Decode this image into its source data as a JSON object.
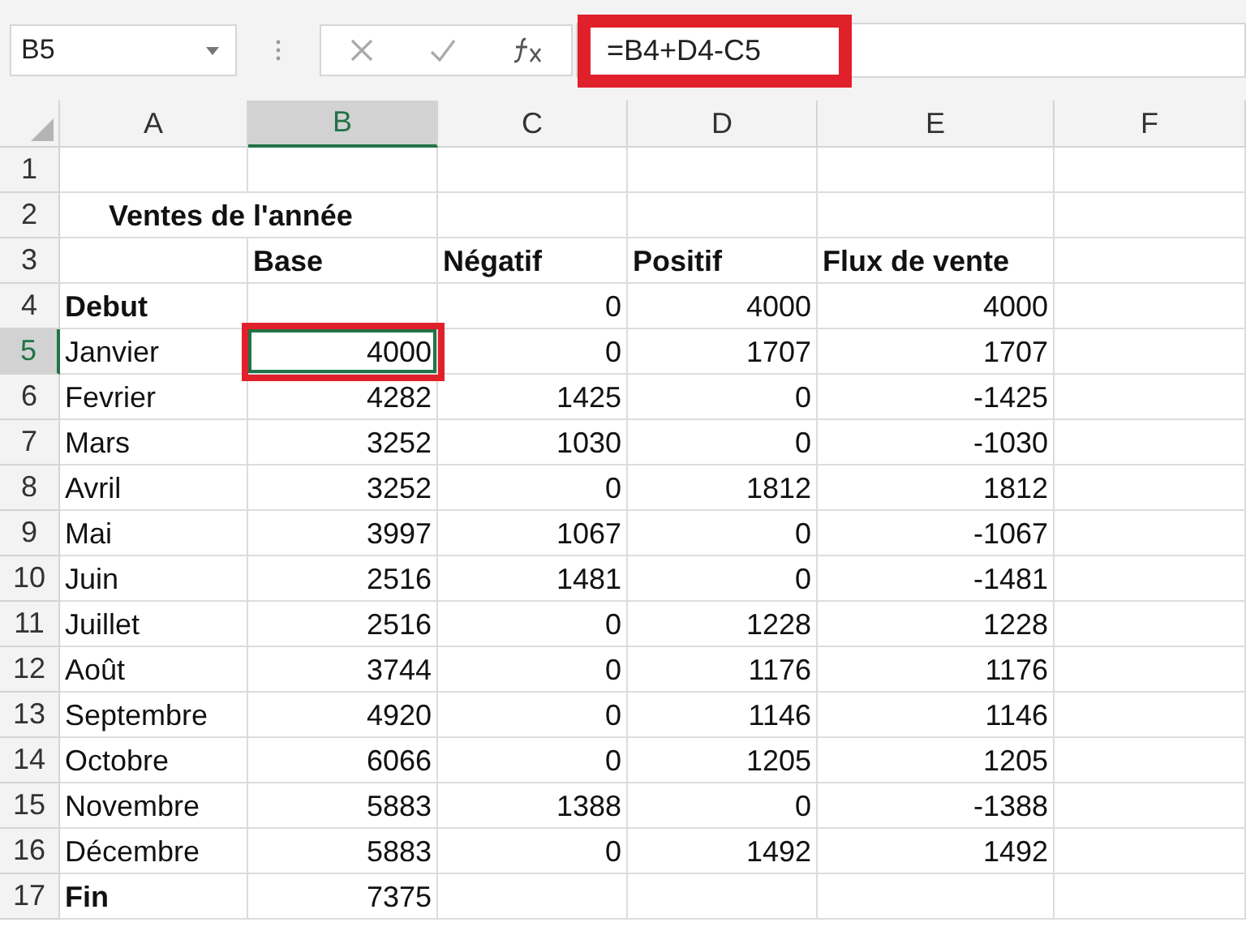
{
  "name_box": {
    "value": "B5"
  },
  "formula_bar": {
    "value": "=B4+D4-C5",
    "highlighted": true
  },
  "columns": [
    {
      "label": "A",
      "selected": false
    },
    {
      "label": "B",
      "selected": true
    },
    {
      "label": "C",
      "selected": false
    },
    {
      "label": "D",
      "selected": false
    },
    {
      "label": "E",
      "selected": false
    },
    {
      "label": "F",
      "selected": false
    }
  ],
  "rows": [
    {
      "label": "1",
      "selected": false,
      "cells": [
        null,
        null,
        null,
        null,
        null,
        null
      ]
    },
    {
      "label": "2",
      "selected": false,
      "cells": [
        {
          "kind": "title",
          "text": "Ventes de l'année",
          "bold": true
        },
        null,
        null,
        null,
        null,
        null
      ]
    },
    {
      "label": "3",
      "selected": false,
      "cells": [
        null,
        {
          "kind": "text",
          "text": "Base",
          "bold": true
        },
        {
          "kind": "text",
          "text": "Négatif",
          "bold": true
        },
        {
          "kind": "text",
          "text": "Positif",
          "bold": true
        },
        {
          "kind": "text",
          "text": "Flux de vente",
          "bold": true
        },
        null
      ]
    },
    {
      "label": "4",
      "selected": false,
      "cells": [
        {
          "kind": "text",
          "text": "Debut",
          "bold": true
        },
        null,
        {
          "kind": "number",
          "text": "0",
          "bold": false
        },
        {
          "kind": "number",
          "text": "4000",
          "bold": false
        },
        {
          "kind": "number",
          "text": "4000",
          "bold": false
        },
        null
      ]
    },
    {
      "label": "5",
      "selected": true,
      "cells": [
        {
          "kind": "text",
          "text": "Janvier",
          "bold": false
        },
        {
          "kind": "number",
          "text": "4000",
          "bold": false,
          "selected": true,
          "highlighted": true
        },
        {
          "kind": "number",
          "text": "0",
          "bold": false
        },
        {
          "kind": "number",
          "text": "1707",
          "bold": false
        },
        {
          "kind": "number",
          "text": "1707",
          "bold": false
        },
        null
      ]
    },
    {
      "label": "6",
      "selected": false,
      "cells": [
        {
          "kind": "text",
          "text": "Fevrier",
          "bold": false
        },
        {
          "kind": "number",
          "text": "4282",
          "bold": false
        },
        {
          "kind": "number",
          "text": "1425",
          "bold": false
        },
        {
          "kind": "number",
          "text": "0",
          "bold": false
        },
        {
          "kind": "number",
          "text": "-1425",
          "bold": false
        },
        null
      ]
    },
    {
      "label": "7",
      "selected": false,
      "cells": [
        {
          "kind": "text",
          "text": "Mars",
          "bold": false
        },
        {
          "kind": "number",
          "text": "3252",
          "bold": false
        },
        {
          "kind": "number",
          "text": "1030",
          "bold": false
        },
        {
          "kind": "number",
          "text": "0",
          "bold": false
        },
        {
          "kind": "number",
          "text": "-1030",
          "bold": false
        },
        null
      ]
    },
    {
      "label": "8",
      "selected": false,
      "cells": [
        {
          "kind": "text",
          "text": "Avril",
          "bold": false
        },
        {
          "kind": "number",
          "text": "3252",
          "bold": false
        },
        {
          "kind": "number",
          "text": "0",
          "bold": false
        },
        {
          "kind": "number",
          "text": "1812",
          "bold": false
        },
        {
          "kind": "number",
          "text": "1812",
          "bold": false
        },
        null
      ]
    },
    {
      "label": "9",
      "selected": false,
      "cells": [
        {
          "kind": "text",
          "text": "Mai",
          "bold": false
        },
        {
          "kind": "number",
          "text": "3997",
          "bold": false
        },
        {
          "kind": "number",
          "text": "1067",
          "bold": false
        },
        {
          "kind": "number",
          "text": "0",
          "bold": false
        },
        {
          "kind": "number",
          "text": "-1067",
          "bold": false
        },
        null
      ]
    },
    {
      "label": "10",
      "selected": false,
      "cells": [
        {
          "kind": "text",
          "text": "Juin",
          "bold": false
        },
        {
          "kind": "number",
          "text": "2516",
          "bold": false
        },
        {
          "kind": "number",
          "text": "1481",
          "bold": false
        },
        {
          "kind": "number",
          "text": "0",
          "bold": false
        },
        {
          "kind": "number",
          "text": "-1481",
          "bold": false
        },
        null
      ]
    },
    {
      "label": "11",
      "selected": false,
      "cells": [
        {
          "kind": "text",
          "text": "Juillet",
          "bold": false
        },
        {
          "kind": "number",
          "text": "2516",
          "bold": false
        },
        {
          "kind": "number",
          "text": "0",
          "bold": false
        },
        {
          "kind": "number",
          "text": "1228",
          "bold": false
        },
        {
          "kind": "number",
          "text": "1228",
          "bold": false
        },
        null
      ]
    },
    {
      "label": "12",
      "selected": false,
      "cells": [
        {
          "kind": "text",
          "text": "Août",
          "bold": false
        },
        {
          "kind": "number",
          "text": "3744",
          "bold": false
        },
        {
          "kind": "number",
          "text": "0",
          "bold": false
        },
        {
          "kind": "number",
          "text": "1176",
          "bold": false
        },
        {
          "kind": "number",
          "text": "1176",
          "bold": false
        },
        null
      ]
    },
    {
      "label": "13",
      "selected": false,
      "cells": [
        {
          "kind": "text",
          "text": "Septembre",
          "bold": false
        },
        {
          "kind": "number",
          "text": "4920",
          "bold": false
        },
        {
          "kind": "number",
          "text": "0",
          "bold": false
        },
        {
          "kind": "number",
          "text": "1146",
          "bold": false
        },
        {
          "kind": "number",
          "text": "1146",
          "bold": false
        },
        null
      ]
    },
    {
      "label": "14",
      "selected": false,
      "cells": [
        {
          "kind": "text",
          "text": "Octobre",
          "bold": false
        },
        {
          "kind": "number",
          "text": "6066",
          "bold": false
        },
        {
          "kind": "number",
          "text": "0",
          "bold": false
        },
        {
          "kind": "number",
          "text": "1205",
          "bold": false
        },
        {
          "kind": "number",
          "text": "1205",
          "bold": false
        },
        null
      ]
    },
    {
      "label": "15",
      "selected": false,
      "cells": [
        {
          "kind": "text",
          "text": "Novembre",
          "bold": false
        },
        {
          "kind": "number",
          "text": "5883",
          "bold": false
        },
        {
          "kind": "number",
          "text": "1388",
          "bold": false
        },
        {
          "kind": "number",
          "text": "0",
          "bold": false
        },
        {
          "kind": "number",
          "text": "-1388",
          "bold": false
        },
        null
      ]
    },
    {
      "label": "16",
      "selected": false,
      "cells": [
        {
          "kind": "text",
          "text": "Décembre",
          "bold": false
        },
        {
          "kind": "number",
          "text": "5883",
          "bold": false
        },
        {
          "kind": "number",
          "text": "0",
          "bold": false
        },
        {
          "kind": "number",
          "text": "1492",
          "bold": false
        },
        {
          "kind": "number",
          "text": "1492",
          "bold": false
        },
        null
      ]
    },
    {
      "label": "17",
      "selected": false,
      "cells": [
        {
          "kind": "text",
          "text": "Fin",
          "bold": true
        },
        {
          "kind": "number",
          "text": "7375",
          "bold": false
        },
        null,
        null,
        null,
        null
      ]
    }
  ]
}
